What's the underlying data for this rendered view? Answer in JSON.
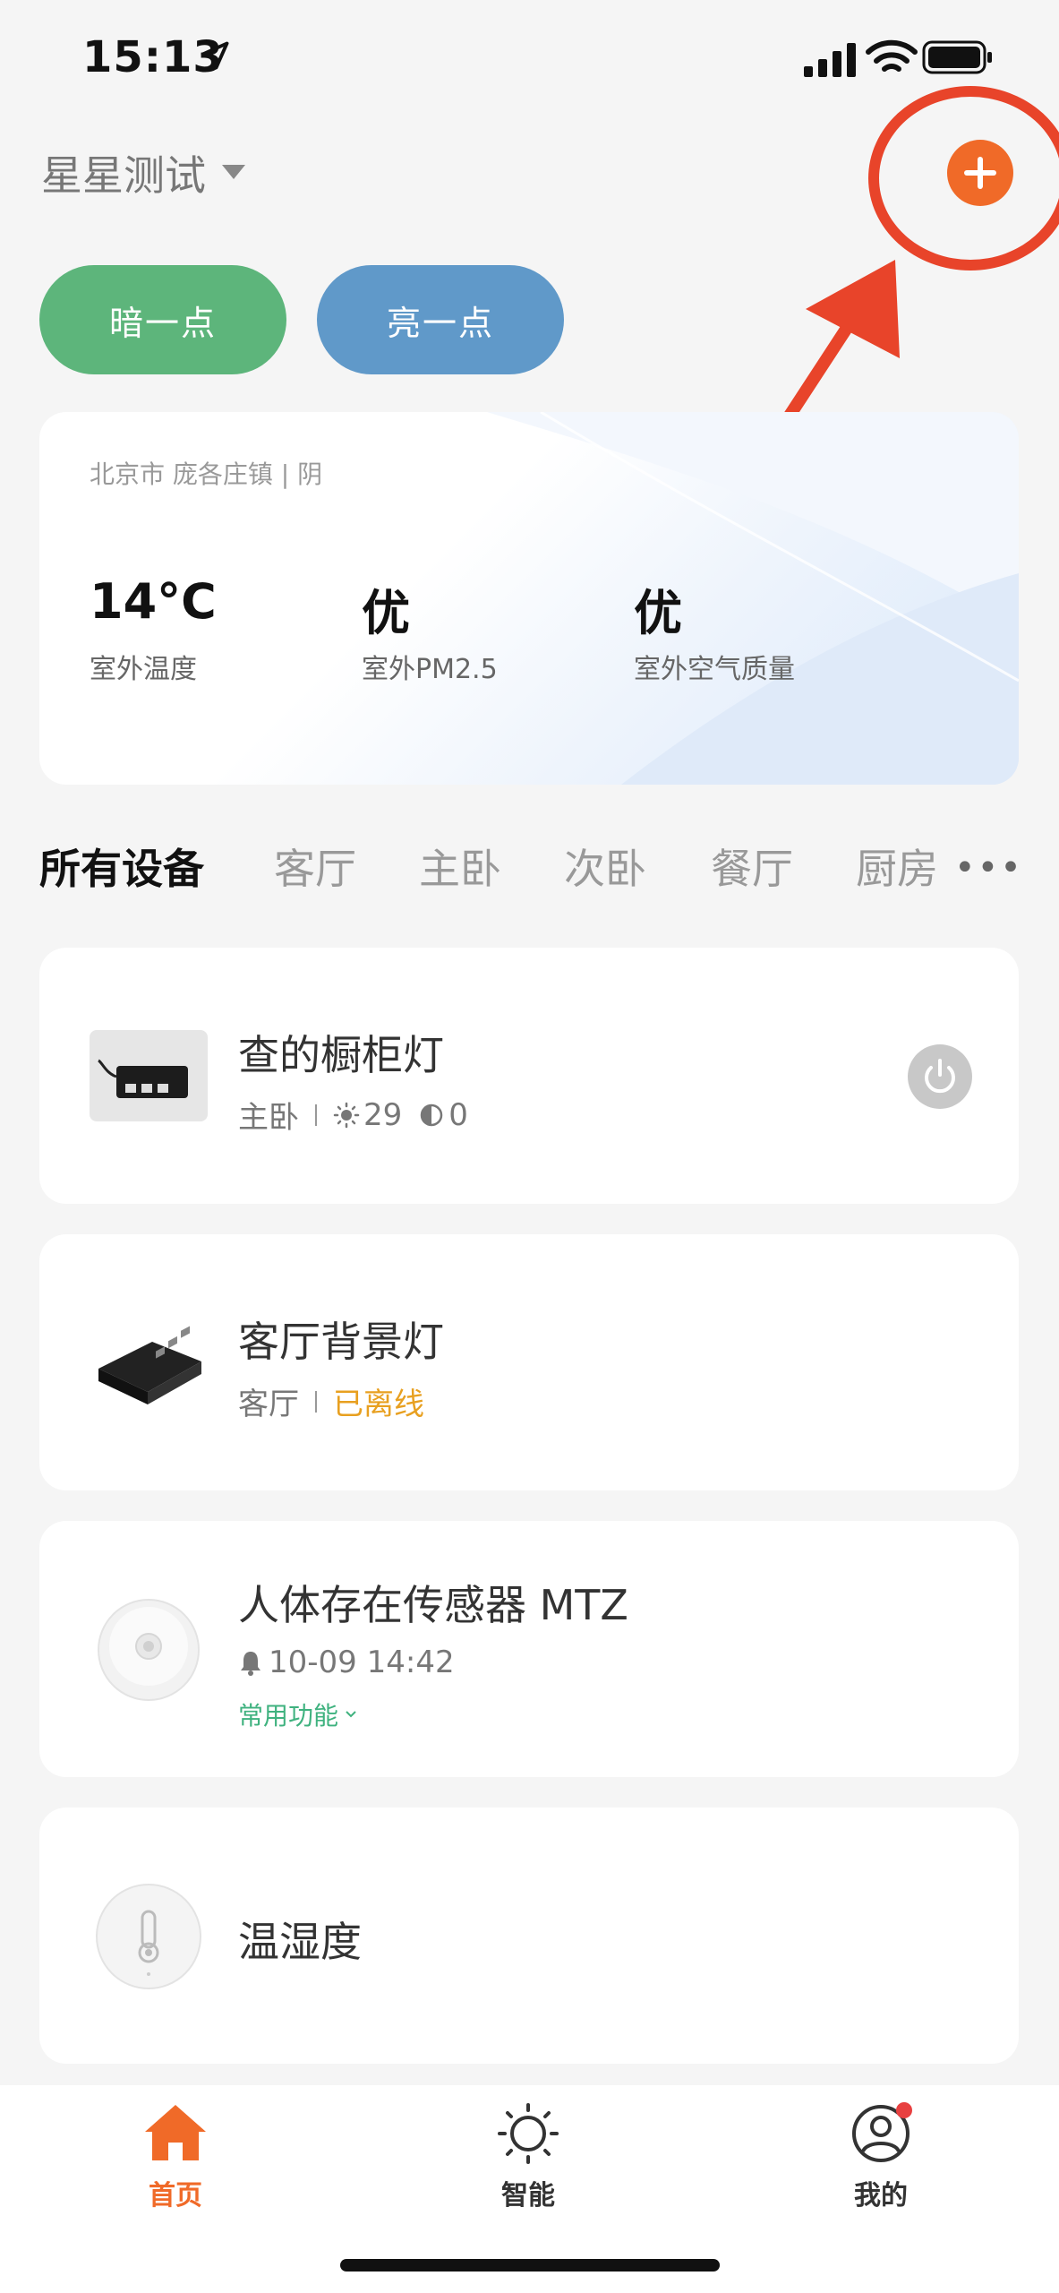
{
  "status_bar": {
    "time": "15:13"
  },
  "header": {
    "home_name": "星星测试"
  },
  "scenes": [
    {
      "label": "暗一点",
      "color": "#5db57b"
    },
    {
      "label": "亮一点",
      "color": "#6099c9"
    }
  ],
  "weather": {
    "location": "北京市 庞各庄镇 | 阴",
    "stats": [
      {
        "value": "14°C",
        "label": "室外温度"
      },
      {
        "value": "优",
        "label": "室外PM2.5"
      },
      {
        "value": "优",
        "label": "室外空气质量"
      }
    ]
  },
  "tabs": [
    "所有设备",
    "客厅",
    "主卧",
    "次卧",
    "餐厅",
    "厨房"
  ],
  "tabs_more": "•••",
  "devices": [
    {
      "name": "查的橱柜灯",
      "room": "主卧",
      "brightness": "29",
      "color_temp": "0",
      "power_icon": "power-icon"
    },
    {
      "name": "客厅背景灯",
      "room": "客厅",
      "status": "已离线",
      "status_color": "#e8a020"
    },
    {
      "name": "人体存在传感器 MTZ",
      "event_time": "10-09 14:42",
      "quick_action": "常用功能"
    },
    {
      "name": "温湿度"
    }
  ],
  "bottom_nav": [
    {
      "label": "首页",
      "icon": "home-icon",
      "active": true,
      "color": "#f06a28"
    },
    {
      "label": "智能",
      "icon": "smart-sun-icon",
      "active": false
    },
    {
      "label": "我的",
      "icon": "profile-icon",
      "active": false,
      "badge": true
    }
  ],
  "accent_color": "#f06a28",
  "annotation_color": "#e8442a"
}
